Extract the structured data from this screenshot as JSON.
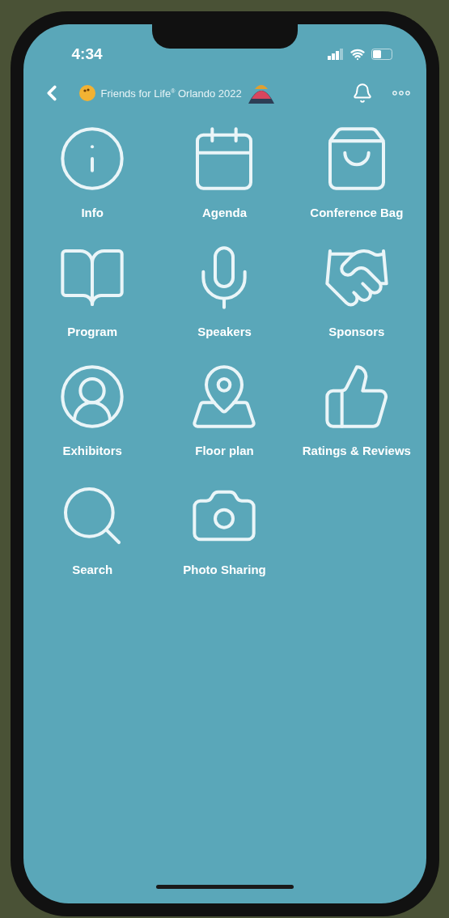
{
  "status_bar": {
    "time": "4:34"
  },
  "header": {
    "title": "Friends for Life$^{®}$ Orlando 2022"
  },
  "tiles": [
    {
      "label": "Info",
      "kind": "info"
    },
    {
      "label": "Agenda",
      "kind": "calendar"
    },
    {
      "label": "Conference Bag",
      "kind": "bag"
    },
    {
      "label": "Program",
      "kind": "book"
    },
    {
      "label": "Speakers",
      "kind": "mic"
    },
    {
      "label": "Sponsors",
      "kind": "handshake"
    },
    {
      "label": "Exhibitors",
      "kind": "person"
    },
    {
      "label": "Floor plan",
      "kind": "map"
    },
    {
      "label": "Ratings & Reviews",
      "kind": "thumb"
    },
    {
      "label": "Search",
      "kind": "search"
    },
    {
      "label": "Photo Sharing",
      "kind": "camera"
    }
  ]
}
